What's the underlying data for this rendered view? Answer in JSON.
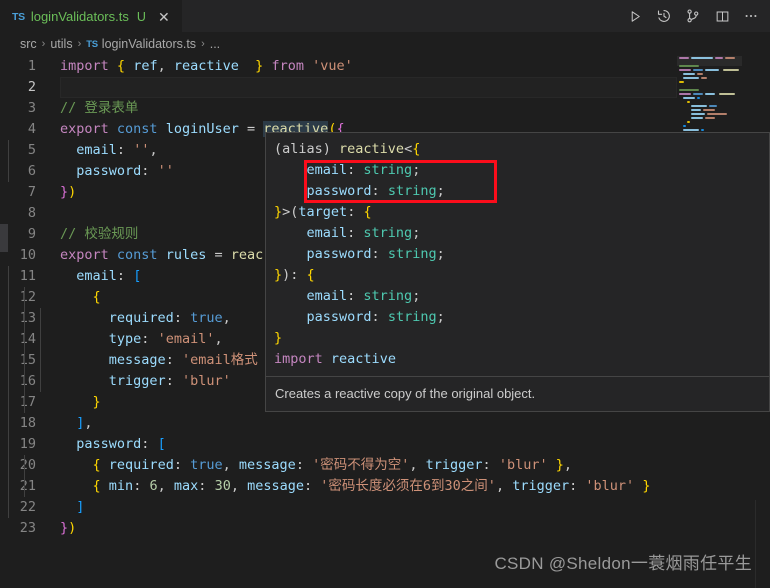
{
  "window": {
    "background": "#1e1e1e"
  },
  "tab": {
    "icon": "typescript-file-icon",
    "icon_label": "TS",
    "filename": "loginValidators.ts",
    "badge": "U",
    "close": "✕"
  },
  "editor_actions": [
    {
      "name": "run-button",
      "label": "Run"
    },
    {
      "name": "timeline-history-button",
      "label": "Timeline"
    },
    {
      "name": "source-control-button",
      "label": "Source Control"
    },
    {
      "name": "split-editor-button",
      "label": "Split Editor Right"
    },
    {
      "name": "more-actions-button",
      "label": "More Actions..."
    }
  ],
  "breadcrumb": {
    "items": [
      "src",
      "utils",
      "loginValidators.ts",
      "..."
    ],
    "file_icon_label": "TS",
    "separator": "›"
  },
  "code": {
    "language": "typescript",
    "lines": [
      {
        "n": "1",
        "text": "import { ref, reactive  } from 'vue'"
      },
      {
        "n": "2",
        "text": "",
        "active": true
      },
      {
        "n": "3",
        "text": "// 登录表单"
      },
      {
        "n": "4",
        "text": "export const loginUser = reactive({"
      },
      {
        "n": "5",
        "text": "  email: '',"
      },
      {
        "n": "6",
        "text": "  password: ''"
      },
      {
        "n": "7",
        "text": "})"
      },
      {
        "n": "8",
        "text": ""
      },
      {
        "n": "9",
        "text": "// 校验规则"
      },
      {
        "n": "10",
        "text": "export const rules = reactive({"
      },
      {
        "n": "11",
        "text": "  email: ["
      },
      {
        "n": "12",
        "text": "    {"
      },
      {
        "n": "13",
        "text": "      required: true,"
      },
      {
        "n": "14",
        "text": "      type: 'email',"
      },
      {
        "n": "15",
        "text": "      message: 'email格式不正确',"
      },
      {
        "n": "16",
        "text": "      trigger: 'blur'"
      },
      {
        "n": "17",
        "text": "    }"
      },
      {
        "n": "18",
        "text": "  ],"
      },
      {
        "n": "19",
        "text": "  password: ["
      },
      {
        "n": "20",
        "text": "    { required: true, message: '密码不得为空', trigger: 'blur' },"
      },
      {
        "n": "21",
        "text": "    { min: 6, max: 30, message: '密码长度必须在6到30之间', trigger: 'blur' }"
      },
      {
        "n": "22",
        "text": "  ]"
      },
      {
        "n": "23",
        "text": "})"
      }
    ],
    "highlighted_word": "reactive"
  },
  "hover": {
    "signature_lines": [
      "(alias) reactive<{",
      "    email: string;",
      "    password: string;",
      "}>(target: {",
      "    email: string;",
      "    password: string;",
      "}): {",
      "    email: string;",
      "    password: string;",
      "}",
      "import reactive"
    ],
    "documentation": "Creates a reactive copy of the original object.",
    "annotation_color": "#fc0d1b"
  },
  "watermark": {
    "text": "CSDN @Sheldon一蓑烟雨任平生"
  }
}
